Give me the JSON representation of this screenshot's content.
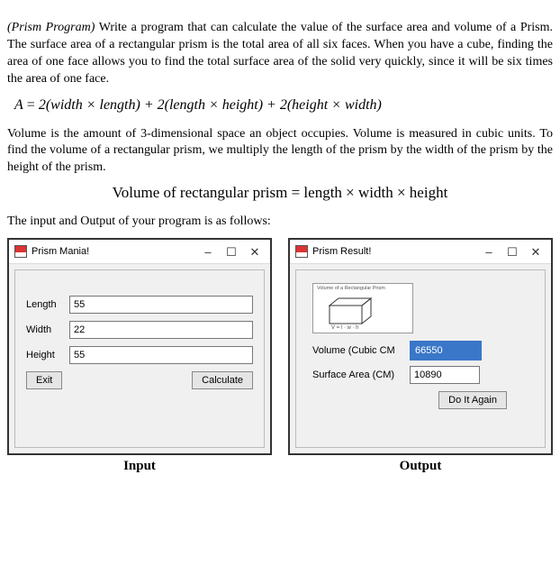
{
  "doc": {
    "title_prefix": "(Prism Program)",
    "intro1": " Write a program that can calculate the value of the surface area and volume of a Prism. The surface area of a rectangular prism is the total area of all six faces. When you have a cube, finding the area of one face allows you to find the total surface area of the solid very quickly, since it will be six times the area of one face.",
    "formula1_A": "A",
    "formula1_eq": " = ",
    "formula1_body": "2(width × length) + 2(length × height) + 2(height × width)",
    "intro2": "Volume is the amount of 3-dimensional space an object occupies. Volume is measured in cubic units. To find the volume of a rectangular prism, we multiply the length of the prism by the width of the prism by the height of the prism.",
    "formula2": "Volume of rectangular prism = length × width × height",
    "io_label": "The input and Output of your program is as follows:"
  },
  "input_win": {
    "title": "Prism Mania!",
    "length_label": "Length",
    "length_value": "55",
    "width_label": "Width",
    "width_value": "22",
    "height_label": "Height",
    "height_value": "55",
    "exit_btn": "Exit",
    "calc_btn": "Calculate"
  },
  "output_win": {
    "title": "Prism Result!",
    "pic_caption_top": "Volume of a Rectangular Prism",
    "pic_caption_bottom": "V = l · w · h",
    "vol_label": "Volume (Cubic CM",
    "vol_value": "66550",
    "sa_label": "Surface Area (CM)",
    "sa_value": "10890",
    "again_btn": "Do It Again"
  },
  "labels": {
    "input_col": "Input",
    "output_col": "Output"
  },
  "winctrl": {
    "min": "—",
    "max": "▢",
    "close": "✕"
  }
}
